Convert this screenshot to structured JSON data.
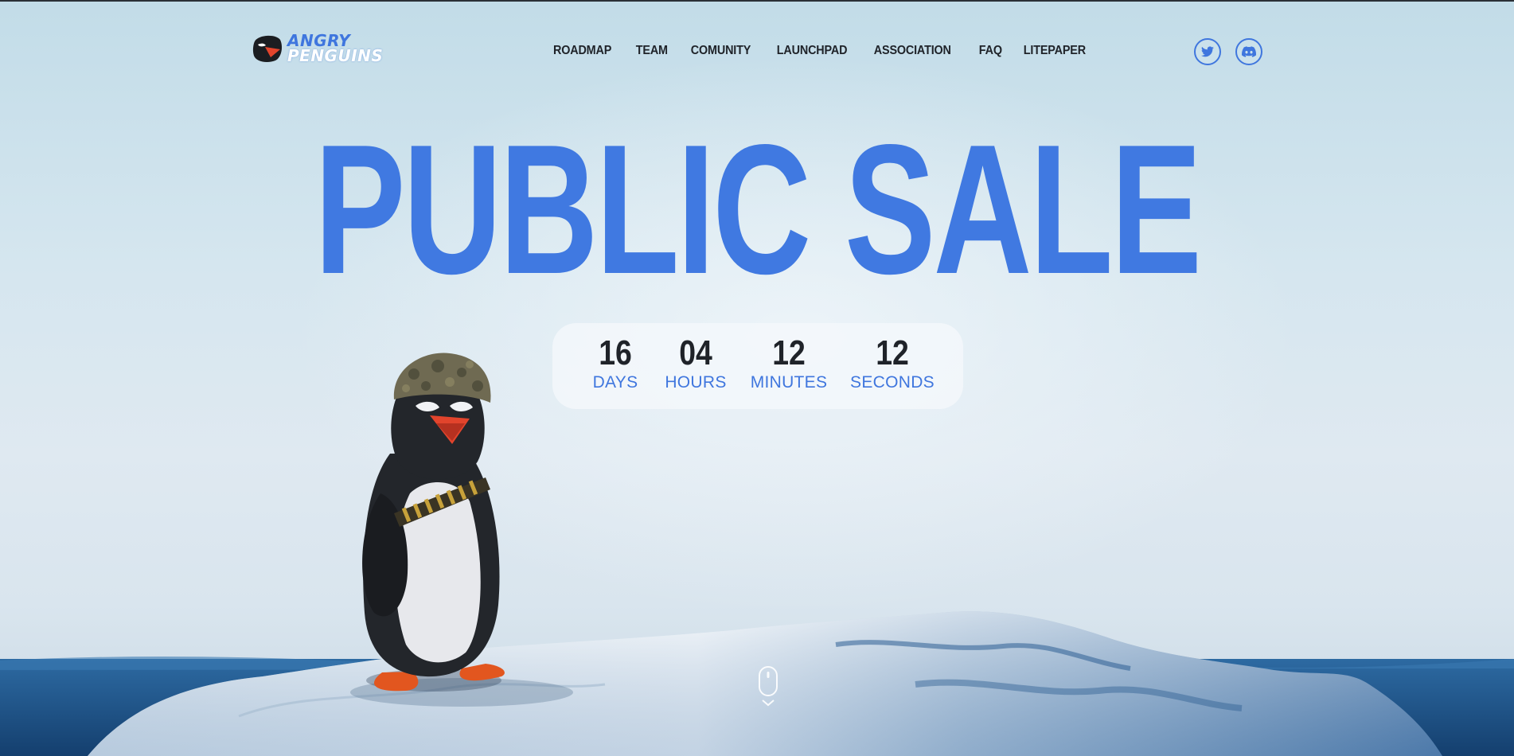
{
  "brand": {
    "line1": "ANGRY",
    "line2": "PENGUINS"
  },
  "nav": {
    "items": [
      "ROADMAP",
      "TEAM",
      "COMUNITY",
      "LAUNCHPAD",
      "ASSOCIATION",
      "FAQ",
      "LITEPAPER"
    ]
  },
  "social": {
    "twitter_icon": "twitter-icon",
    "discord_icon": "discord-icon"
  },
  "hero": {
    "title": "PUBLIC SALE"
  },
  "countdown": {
    "days": "16",
    "days_label": "DAYS",
    "hours": "04",
    "hours_label": "HOURS",
    "minutes": "12",
    "minutes_label": "MINUTES",
    "seconds": "12",
    "seconds_label": "SECONDS"
  },
  "colors": {
    "accent": "#4079e1",
    "text_dark": "#1f2329",
    "sky": "#d5e6ef",
    "sea": "#2f6fa8"
  },
  "icons": {
    "scroll": "mouse-scroll-icon",
    "mascot": "penguin-illustration"
  }
}
